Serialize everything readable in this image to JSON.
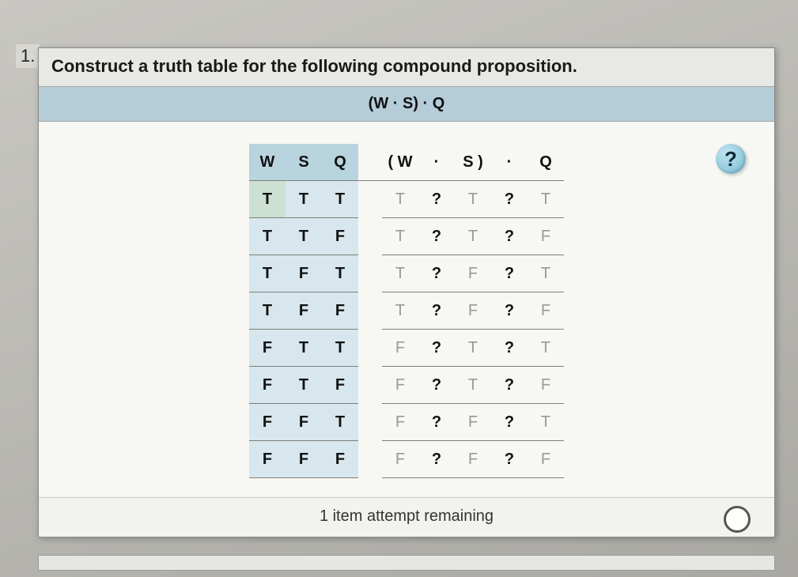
{
  "question_number": "1.",
  "prompt": "Construct a truth table for the following compound proposition.",
  "expression": "(W · S) · Q",
  "help_label": "?",
  "headers": {
    "inputs": [
      "W",
      "S",
      "Q"
    ],
    "formula": [
      "( W",
      "·",
      "S )",
      "·",
      "Q"
    ]
  },
  "rows": [
    {
      "in": [
        "T",
        "T",
        "T"
      ],
      "out": [
        "T",
        "?",
        "T",
        "?",
        "T"
      ]
    },
    {
      "in": [
        "T",
        "T",
        "F"
      ],
      "out": [
        "T",
        "?",
        "T",
        "?",
        "F"
      ]
    },
    {
      "in": [
        "T",
        "F",
        "T"
      ],
      "out": [
        "T",
        "?",
        "F",
        "?",
        "T"
      ]
    },
    {
      "in": [
        "T",
        "F",
        "F"
      ],
      "out": [
        "T",
        "?",
        "F",
        "?",
        "F"
      ]
    },
    {
      "in": [
        "F",
        "T",
        "T"
      ],
      "out": [
        "F",
        "?",
        "T",
        "?",
        "T"
      ]
    },
    {
      "in": [
        "F",
        "T",
        "F"
      ],
      "out": [
        "F",
        "?",
        "T",
        "?",
        "F"
      ]
    },
    {
      "in": [
        "F",
        "F",
        "T"
      ],
      "out": [
        "F",
        "?",
        "F",
        "?",
        "T"
      ]
    },
    {
      "in": [
        "F",
        "F",
        "F"
      ],
      "out": [
        "F",
        "?",
        "F",
        "?",
        "F"
      ]
    }
  ],
  "footer": "1 item attempt remaining"
}
